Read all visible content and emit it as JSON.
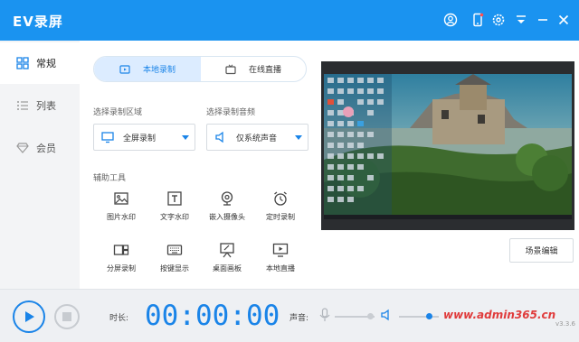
{
  "app": {
    "title": "EV录屏"
  },
  "titlebar": {
    "icons": [
      "user-icon",
      "phone-icon",
      "settings-icon",
      "dropdown-icon",
      "minimize-icon",
      "close-icon"
    ]
  },
  "sidebar": {
    "items": [
      {
        "label": "常规",
        "icon": "grid-icon",
        "active": true
      },
      {
        "label": "列表",
        "icon": "list-icon",
        "active": false
      },
      {
        "label": "会员",
        "icon": "diamond-icon",
        "active": false
      }
    ]
  },
  "modes": {
    "local_record": "本地录制",
    "live_stream": "在线直播"
  },
  "area": {
    "label": "选择录制区域",
    "value": "全屏录制"
  },
  "audio": {
    "label": "选择录制音频",
    "value": "仅系统声音"
  },
  "tools": {
    "label": "辅助工具",
    "items": [
      {
        "label": "图片水印",
        "icon": "image-icon"
      },
      {
        "label": "文字水印",
        "icon": "text-icon"
      },
      {
        "label": "嵌入摄像头",
        "icon": "webcam-icon"
      },
      {
        "label": "定时录制",
        "icon": "alarm-icon"
      },
      {
        "label": "分屏录制",
        "icon": "split-screen-icon"
      },
      {
        "label": "按键显示",
        "icon": "keyboard-icon"
      },
      {
        "label": "桌面画板",
        "icon": "easel-icon"
      },
      {
        "label": "本地直播",
        "icon": "monitor-play-icon"
      }
    ]
  },
  "scene_button": "场景编辑",
  "bottom": {
    "time_label": "时长:",
    "time": "00:00:00",
    "volume_label": "声音:",
    "mic_level": 0.9,
    "speaker_level": 0.75,
    "watermark": "www.admin365.cn",
    "version": "v3.3.6"
  },
  "colors": {
    "accent": "#1a84e8",
    "titlebar": "#1a93f0",
    "watermark": "#e03b3b"
  }
}
